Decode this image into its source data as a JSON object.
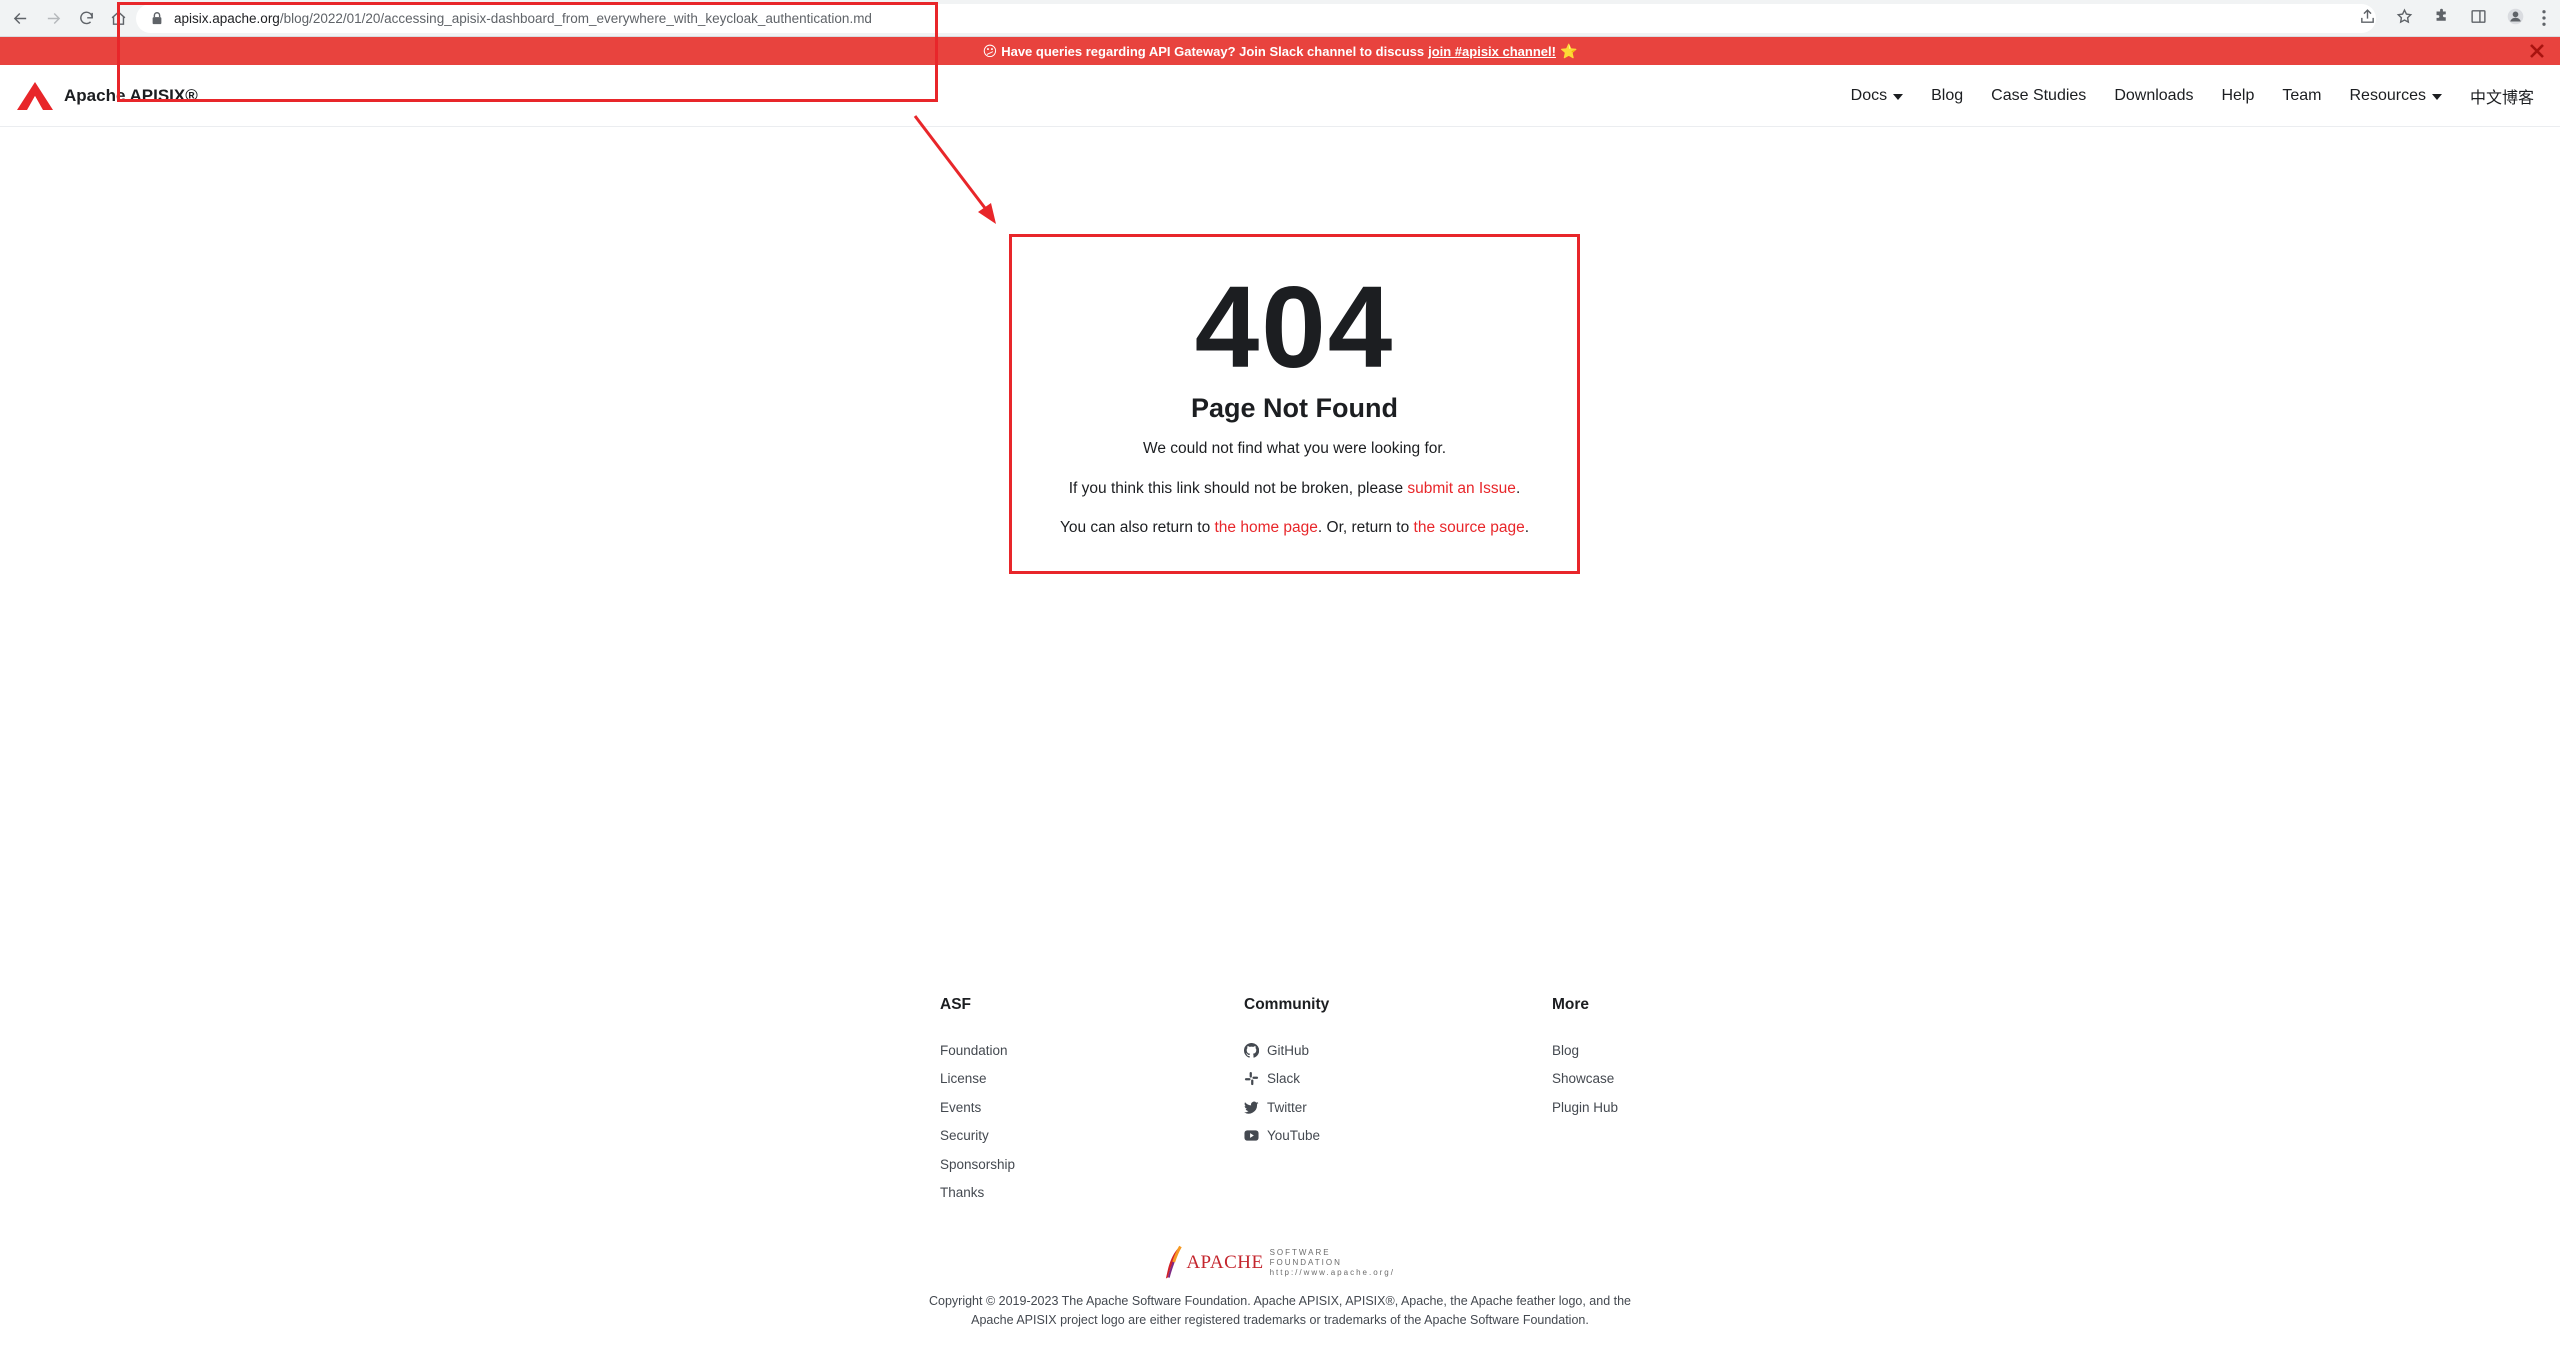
{
  "browser": {
    "url_host": "apisix.apache.org",
    "url_path": "/blog/2022/01/20/accessing_apisix-dashboard_from_everywhere_with_keycloak_authentication.md"
  },
  "announcement": {
    "emoji": "😕",
    "text": "Have queries regarding API Gateway? Join Slack channel to discuss",
    "link": "join #apisix channel!",
    "trailing_emoji": "⭐"
  },
  "navbar": {
    "brand": "Apache APISIX®",
    "items": [
      {
        "label": "Docs",
        "dropdown": true
      },
      {
        "label": "Blog"
      },
      {
        "label": "Case Studies"
      },
      {
        "label": "Downloads"
      },
      {
        "label": "Help"
      },
      {
        "label": "Team"
      },
      {
        "label": "Resources",
        "dropdown": true
      },
      {
        "label": "中文博客"
      }
    ]
  },
  "not_found": {
    "code": "404",
    "title": "Page Not Found",
    "line1": "We could not find what you were looking for.",
    "line2_prefix": "If you think this link should not be broken, please ",
    "line2_link": "submit an Issue",
    "line2_suffix": ".",
    "line3_prefix": "You can also return to ",
    "line3_link1": "the home page",
    "line3_mid": ". Or, return to ",
    "line3_link2": "the source page",
    "line3_suffix": "."
  },
  "footer": {
    "asf": {
      "title": "ASF",
      "items": [
        "Foundation",
        "License",
        "Events",
        "Security",
        "Sponsorship",
        "Thanks"
      ]
    },
    "community": {
      "title": "Community",
      "items": [
        {
          "label": "GitHub",
          "icon": "github-icon"
        },
        {
          "label": "Slack",
          "icon": "slack-icon"
        },
        {
          "label": "Twitter",
          "icon": "twitter-icon"
        },
        {
          "label": "YouTube",
          "icon": "youtube-icon"
        }
      ]
    },
    "more": {
      "title": "More",
      "items": [
        "Blog",
        "Showcase",
        "Plugin Hub"
      ]
    },
    "apache_word": "APACHE",
    "apache_sub1": "SOFTWARE FOUNDATION",
    "apache_sub2": "http://www.apache.org/",
    "copyright1": "Copyright © 2019-2023 The Apache Software Foundation. Apache APISIX, APISIX®, Apache, the Apache feather logo, and the",
    "copyright2": "Apache APISIX project logo are either registered trademarks or trademarks of the Apache Software Foundation."
  },
  "colors": {
    "accent": "#e8262a",
    "announce_bg": "#e8433e"
  }
}
